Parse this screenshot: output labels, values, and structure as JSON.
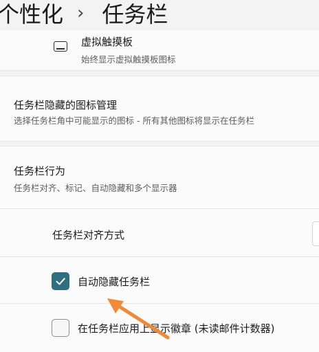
{
  "breadcrumb": {
    "parent": "个性化",
    "separator": "›",
    "current": "任务栏"
  },
  "touchpad": {
    "title": "虚拟触摸板",
    "description": "始终显示虚拟触摸板图标",
    "icon": "touchpad-icon"
  },
  "hidden_icons": {
    "title": "任务栏隐藏的图标管理",
    "description": "选择任务栏角中可能显示的图标 - 所有其他图标将显示在任务栏"
  },
  "behaviors": {
    "title": "任务栏行为",
    "description": "任务栏对齐、标记、自动隐藏和多个显示器",
    "alignment_label": "任务栏对齐方式",
    "auto_hide": {
      "label": "自动隐藏任务栏",
      "checked": true
    },
    "badges": {
      "label": "在任务栏应用上显示徽章 (未读邮件计数器)",
      "checked": false
    }
  },
  "colors": {
    "accent": "#2f6f80",
    "arrow": "#f08a38"
  }
}
